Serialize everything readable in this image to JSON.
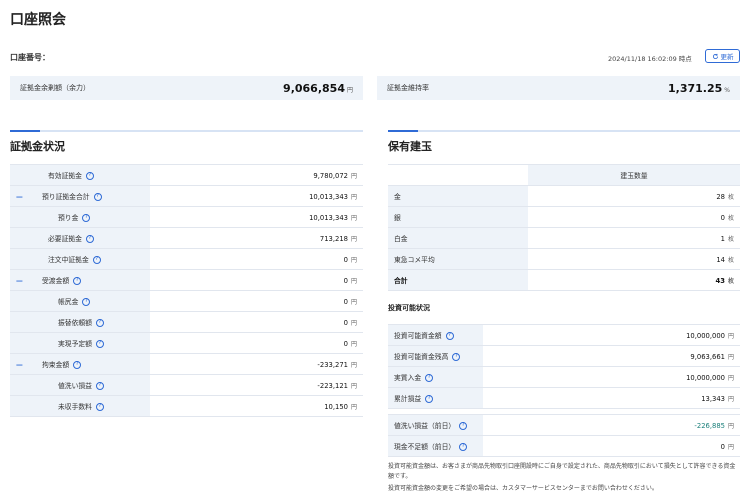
{
  "page": {
    "title": "口座照会",
    "account_label": "口座番号：",
    "timestamp": "2024/11/18 16:02:09 時点",
    "refresh_label": "更新"
  },
  "summary": {
    "margin_balance": {
      "label": "証拠金余剰額（余力）",
      "value": "9,066,854",
      "unit": "円"
    },
    "maintenance_ratio": {
      "label": "証拠金維持率",
      "value": "1,371.25",
      "unit": "%"
    }
  },
  "margin_status": {
    "title": "証拠金状況",
    "rows": [
      {
        "label": "有効証拠金",
        "value": "9,780,072",
        "unit": "円",
        "level": 0,
        "toggle": false
      },
      {
        "label": "預り証拠金合計",
        "value": "10,013,343",
        "unit": "円",
        "level": 0,
        "toggle": true
      },
      {
        "label": "預り金",
        "value": "10,013,343",
        "unit": "円",
        "level": 1,
        "toggle": false
      },
      {
        "label": "必要証拠金",
        "value": "713,218",
        "unit": "円",
        "level": 0,
        "toggle": false
      },
      {
        "label": "注文中証拠金",
        "value": "0",
        "unit": "円",
        "level": 0,
        "toggle": false
      },
      {
        "label": "受渡金額",
        "value": "0",
        "unit": "円",
        "level": 0,
        "toggle": true
      },
      {
        "label": "帳尻金",
        "value": "0",
        "unit": "円",
        "level": 1,
        "toggle": false
      },
      {
        "label": "振替依頼額",
        "value": "0",
        "unit": "円",
        "level": 1,
        "toggle": false
      },
      {
        "label": "実現予定額",
        "value": "0",
        "unit": "円",
        "level": 1,
        "toggle": false
      },
      {
        "label": "拘束金額",
        "value": "-233,271",
        "unit": "円",
        "level": 0,
        "toggle": true
      },
      {
        "label": "値洗い損益",
        "value": "-223,121",
        "unit": "円",
        "level": 1,
        "toggle": false
      },
      {
        "label": "未収手数料",
        "value": "10,150",
        "unit": "円",
        "level": 1,
        "toggle": false
      }
    ]
  },
  "positions": {
    "title": "保有建玉",
    "column_header": "建玉数量",
    "rows": [
      {
        "label": "金",
        "value": "28",
        "unit": "枚"
      },
      {
        "label": "銀",
        "value": "0",
        "unit": "枚"
      },
      {
        "label": "白金",
        "value": "1",
        "unit": "枚"
      },
      {
        "label": "東急コメ平均",
        "value": "14",
        "unit": "枚"
      }
    ],
    "total": {
      "label": "合計",
      "value": "43",
      "unit": "枚"
    }
  },
  "investable": {
    "title": "投資可能状況",
    "rows": [
      {
        "label": "投資可能資金額",
        "value": "10,000,000",
        "unit": "円"
      },
      {
        "label": "投資可能資金残高",
        "value": "9,063,661",
        "unit": "円"
      },
      {
        "label": "実質入金",
        "value": "10,000,000",
        "unit": "円"
      },
      {
        "label": "累計損益",
        "value": "13,343",
        "unit": "円"
      }
    ],
    "prev_rows": [
      {
        "label": "値洗い損益（前日）",
        "value": "-226,885",
        "unit": "円"
      },
      {
        "label": "現金不足額（前日）",
        "value": "0",
        "unit": "円"
      }
    ]
  },
  "notes": {
    "line1": "投資可能資金額は、お客さまが商品先物取引口座開設時にご自身で設定された、商品先物取引において損失として許容できる資金額です。",
    "line2": "投資可能資金額の変更をご希望の場合は、カスタマーサービスセンターまでお問い合わせください。"
  },
  "colors": {
    "accent": "#2f6bd6",
    "label_bg": "#eef3f9",
    "negative_pl": "#1a7f7a"
  }
}
